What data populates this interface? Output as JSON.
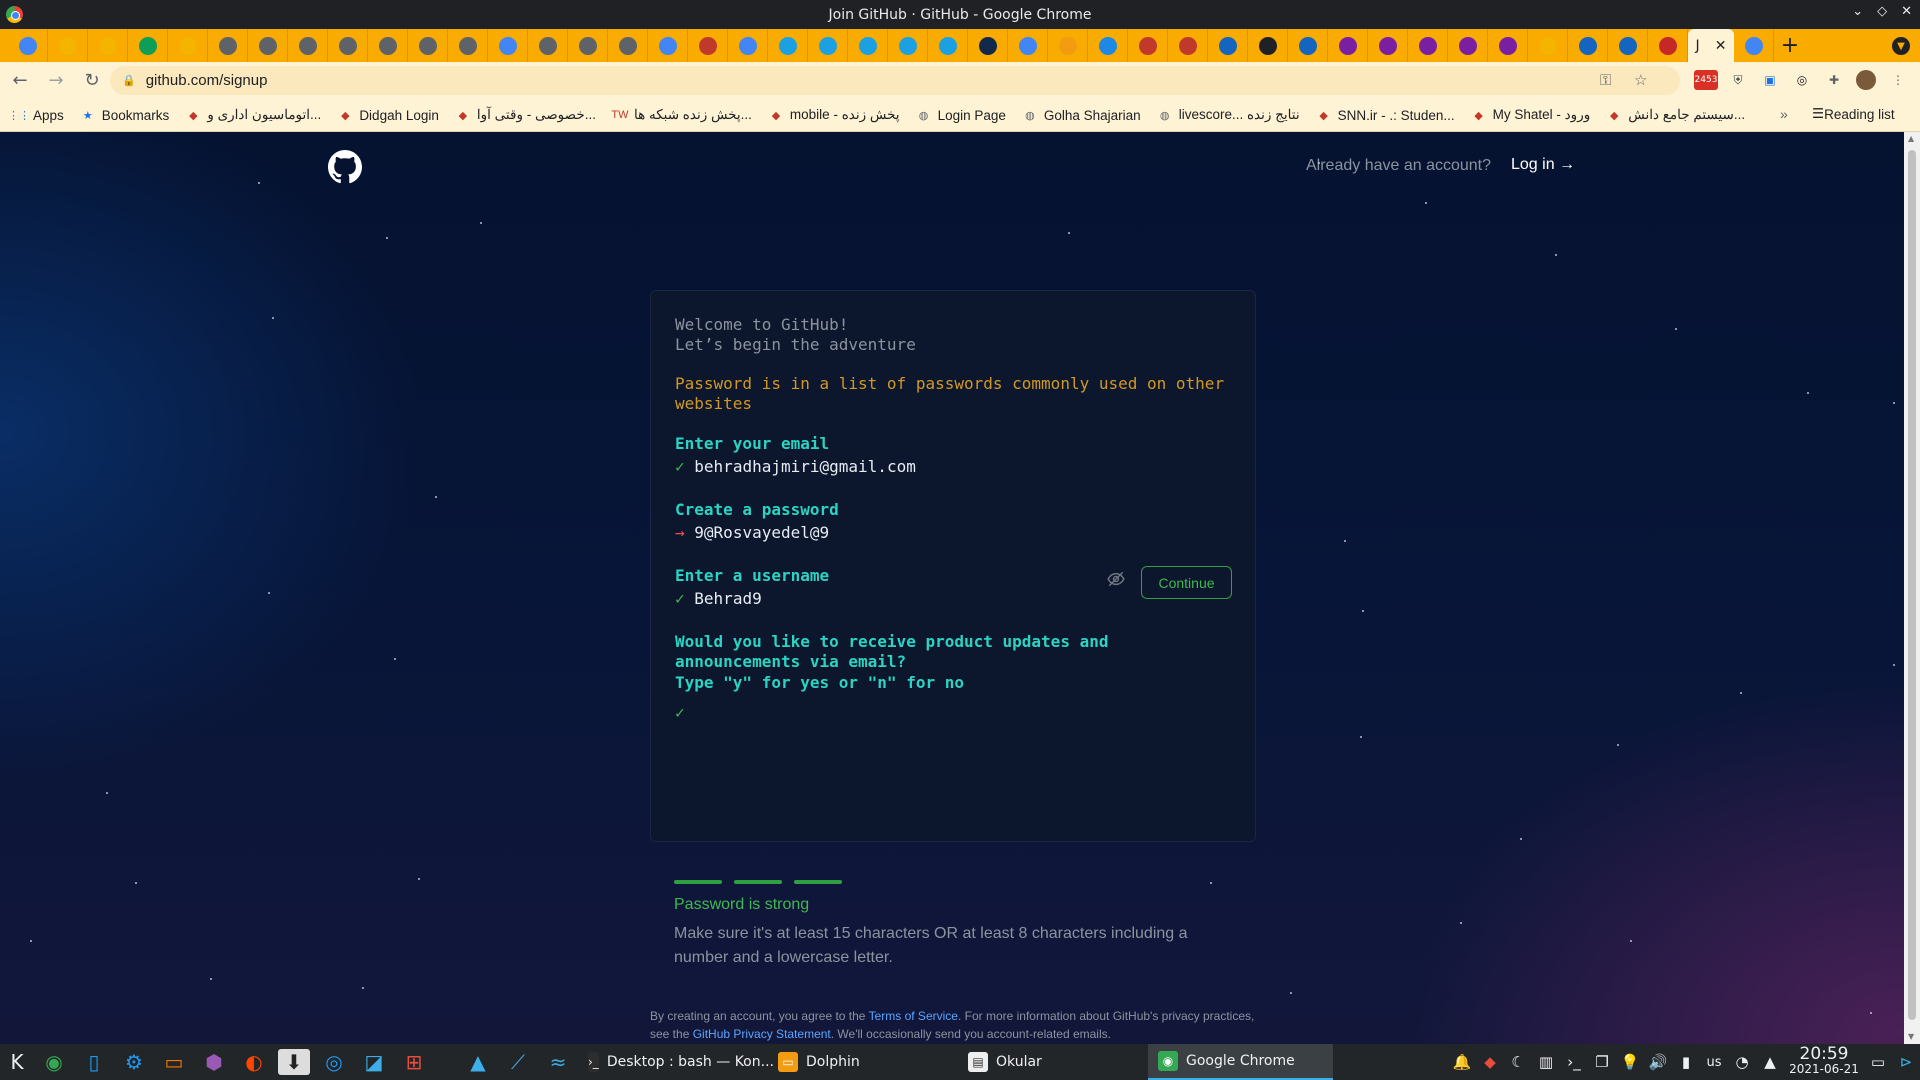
{
  "window": {
    "title": "Join GitHub · GitHub - Google Chrome"
  },
  "tabs": {
    "favicon_count": 43,
    "active_tab_label": "J",
    "new_tab_label": "+"
  },
  "toolbar": {
    "url": "github.com/signup"
  },
  "bookmarks": {
    "items": [
      {
        "label": "Apps",
        "icon": "apps-grid-icon"
      },
      {
        "label": "Bookmarks",
        "icon": "star-icon"
      },
      {
        "label": "اتوماسیون اداری و...",
        "icon": "site-icon"
      },
      {
        "label": "Didgah Login",
        "icon": "site-icon"
      },
      {
        "label": "خصوصی - وقتی آوا...",
        "icon": "site-icon"
      },
      {
        "label": "پخش زنده شبکه ها...",
        "icon": "tw-icon"
      },
      {
        "label": "mobile - پخش زنده",
        "icon": "site-icon"
      },
      {
        "label": "Login Page",
        "icon": "globe-icon"
      },
      {
        "label": "Golha Shajarian",
        "icon": "globe-icon"
      },
      {
        "label": "livescore... نتایج زنده",
        "icon": "globe-icon"
      },
      {
        "label": "SNN.ir - .: Studen...",
        "icon": "site-icon"
      },
      {
        "label": "My Shatel - ورود",
        "icon": "site-icon"
      },
      {
        "label": "سیستم جامع دانش...",
        "icon": "site-icon"
      }
    ],
    "more": "»",
    "reading_list": "Reading list"
  },
  "page": {
    "already_have_account": "Already have an account?",
    "login_link": "Log in →",
    "welcome_line1": "Welcome to GitHub!",
    "welcome_line2": "Let’s begin the adventure",
    "warning_line1": "Password is in a list of passwords commonly used on other",
    "warning_line2": "websites",
    "email_label": "Enter your email",
    "email_value": "behradhajmiri@gmail.com",
    "password_label": "Create a password",
    "password_value": "9@Rosvayedel@9",
    "continue_button": "Continue",
    "username_label": "Enter a username",
    "username_value": "Behrad9",
    "updates_q_line1": "Would you like to receive product updates and",
    "updates_q_line2": "announcements via email?",
    "updates_q_line3": "Type \"y\" for yes or \"n\" for no",
    "check_mark": "✓",
    "arrow_mark": "→",
    "strength_title": "Password is strong",
    "strength_hint": "Make sure it's at least 15 characters OR at least 8 characters including a number and a lowercase letter.",
    "legal_prefix": "By creating an account, you agree to the ",
    "legal_terms": "Terms of Service",
    "legal_middle": ". For more information about GitHub's privacy practices, see the ",
    "legal_privacy": "GitHub Privacy Statement",
    "legal_suffix": ". We'll occasionally send you account-related emails."
  },
  "taskbar": {
    "tasks": [
      {
        "label": "Desktop : bash — Kon...",
        "icon": "terminal-icon"
      },
      {
        "label": "Dolphin",
        "icon": "folder-icon"
      },
      {
        "label": "Okular",
        "icon": "document-icon"
      },
      {
        "label": "Google Chrome",
        "icon": "chrome-icon",
        "active": true
      }
    ],
    "keyboard_layout": "us",
    "time": "20:59",
    "date": "2021-06-21"
  },
  "extensions": {
    "gmail_badge": "2453"
  },
  "colors": {
    "tab_strip": "#f9ab00",
    "toolbar": "#fff3d6",
    "card_bg": "#0c162d",
    "teal_label": "#2bd4c2",
    "success_green": "#3fb950",
    "warning_amber": "#d29922"
  }
}
